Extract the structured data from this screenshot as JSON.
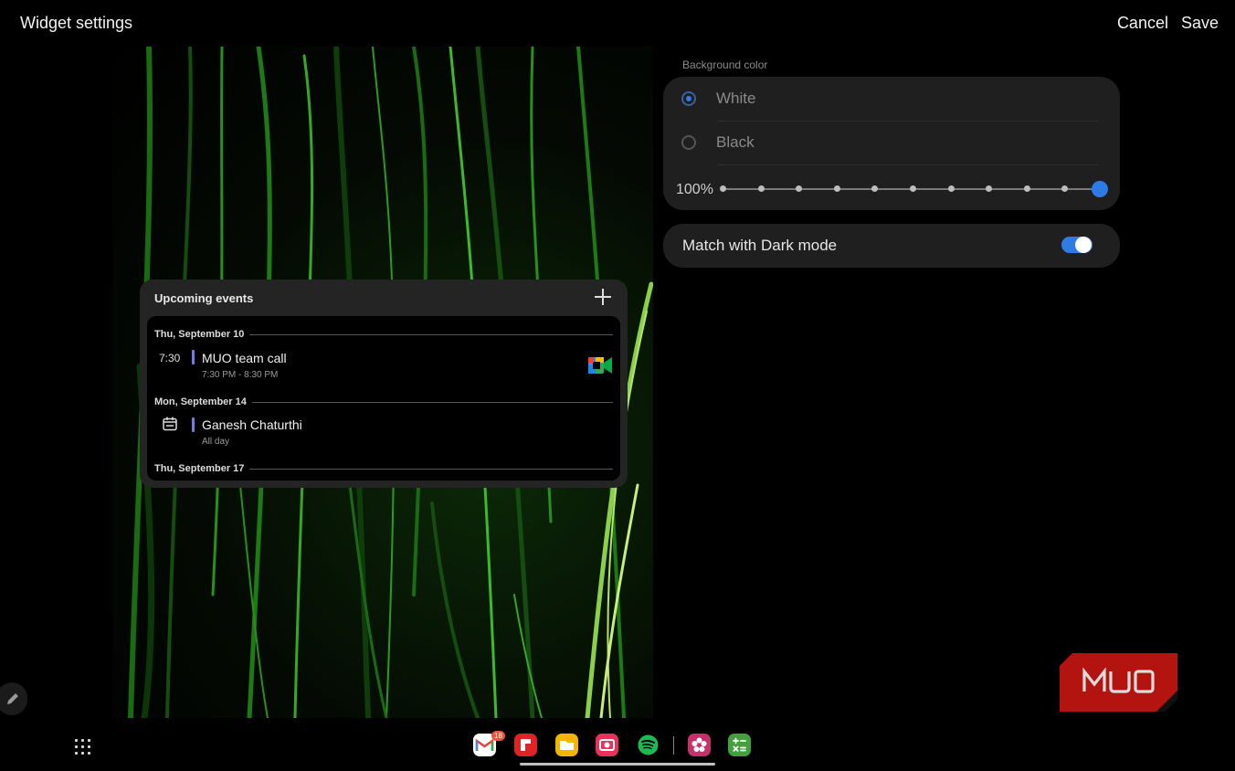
{
  "header": {
    "title": "Widget settings",
    "cancel_label": "Cancel",
    "save_label": "Save"
  },
  "widget": {
    "title": "Upcoming events",
    "days": [
      {
        "date": "Thu, September 10",
        "events": [
          {
            "time": "7:30",
            "title": "MUO team call",
            "subtitle": "7:30 PM - 8:30 PM",
            "icon": "google-meet-icon"
          }
        ]
      },
      {
        "date": "Mon, September 14",
        "events": [
          {
            "icon": "calendar-icon",
            "title": "Ganesh Chaturthi",
            "subtitle": "All day"
          }
        ]
      },
      {
        "date": "Thu, September 17",
        "events": []
      }
    ]
  },
  "settings": {
    "background_color_label": "Background color",
    "options": [
      {
        "label": "White",
        "selected": true
      },
      {
        "label": "Black",
        "selected": false
      }
    ],
    "transparency_percent": "100%",
    "slider_fraction": 1.0,
    "match_dark_mode_label": "Match with Dark mode",
    "match_dark_mode_on": true
  },
  "dock": {
    "gmail_badge": "18",
    "apps": [
      "gmail-icon",
      "flipboard-icon",
      "files-icon",
      "camera-icon",
      "spotify-icon",
      "blossom-icon",
      "calculator-icon"
    ]
  },
  "watermark": {
    "text": "MUO"
  },
  "colors": {
    "accent": "#2f7be6",
    "event_bar": "#6f7fe0",
    "card": "#1f1f1f"
  }
}
